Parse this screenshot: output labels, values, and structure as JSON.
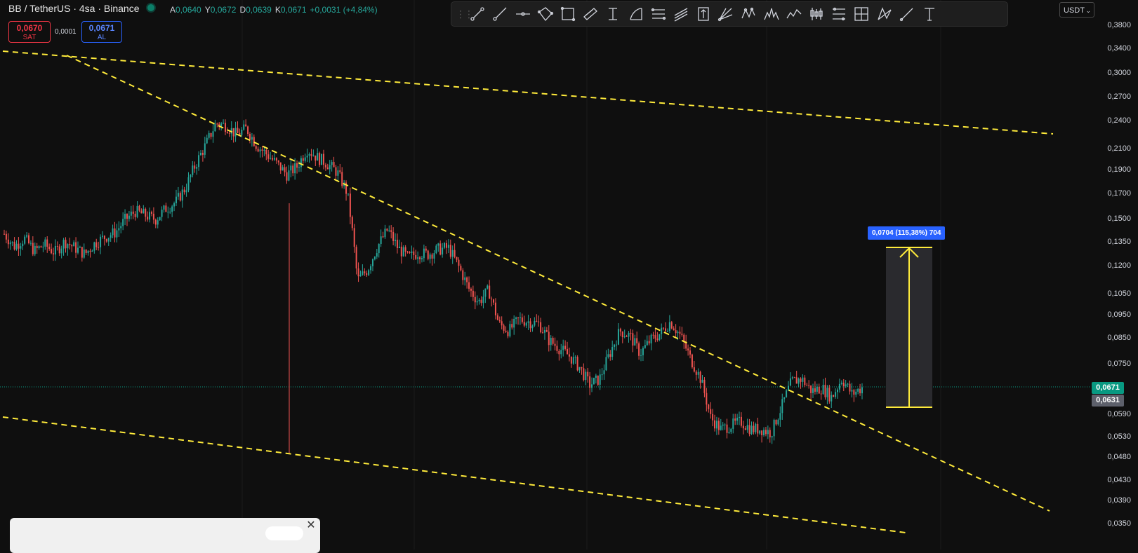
{
  "legend": {
    "symbol": "BB / TetherUS · 4sa · Binance",
    "ohlc": [
      {
        "k": "A",
        "v": "0,0640"
      },
      {
        "k": "Y",
        "v": "0,0672"
      },
      {
        "k": "D",
        "v": "0,0639"
      },
      {
        "k": "K",
        "v": "0,0671"
      },
      {
        "k": "",
        "v": "+0,0031 (+4,84%)"
      }
    ]
  },
  "trade": {
    "sell_price": "0,0670",
    "sell_label": "SAT",
    "spread": "0,0001",
    "buy_price": "0,0671",
    "buy_label": "AL"
  },
  "currency": "USDT",
  "toolbar": {
    "tools": [
      "trend-line",
      "ray",
      "horizontal-line",
      "parallel-channel",
      "rectangle",
      "rotated-rectangle",
      "cross-line",
      "arc",
      "fib-retracement",
      "regression-trend",
      "long-position",
      "pitchfork",
      "xabcd-pattern",
      "head-and-shoulders",
      "elliott-wave",
      "candle-pattern",
      "price-range",
      "date-price-range",
      "triangle-pattern",
      "brush",
      "text"
    ]
  },
  "price_scale": {
    "ticks": [
      "0,3800",
      "0,3400",
      "0,3000",
      "0,2700",
      "0,2400",
      "0,2100",
      "0,1900",
      "0,1700",
      "0,1500",
      "0,1350",
      "0,1200",
      "0,1050",
      "0,0950",
      "0,0850",
      "0,0750",
      "0,0671",
      "0,0631",
      "0,0590",
      "0,0530",
      "0,0480",
      "0,0430",
      "0,0390",
      "0,0350"
    ],
    "current_price": "0,0671",
    "current_color": "#089981",
    "secondary_price": "0,0631",
    "secondary_color": "#5d606b"
  },
  "measure": {
    "label": "0,0704 (115,38%) 704",
    "color": "#2962ff"
  },
  "chart_data": {
    "type": "candlestick",
    "scale": "log",
    "ylim": [
      0.034,
      0.39
    ],
    "close_series": [
      0.14,
      0.132,
      0.137,
      0.129,
      0.133,
      0.128,
      0.135,
      0.131,
      0.127,
      0.134,
      0.138,
      0.141,
      0.15,
      0.156,
      0.153,
      0.15,
      0.158,
      0.163,
      0.175,
      0.196,
      0.215,
      0.238,
      0.235,
      0.225,
      0.232,
      0.214,
      0.205,
      0.196,
      0.186,
      0.193,
      0.21,
      0.202,
      0.196,
      0.188,
      0.17,
      0.112,
      0.118,
      0.132,
      0.143,
      0.131,
      0.125,
      0.128,
      0.127,
      0.13,
      0.131,
      0.12,
      0.108,
      0.101,
      0.107,
      0.091,
      0.088,
      0.093,
      0.092,
      0.091,
      0.084,
      0.081,
      0.078,
      0.074,
      0.068,
      0.07,
      0.079,
      0.088,
      0.086,
      0.079,
      0.084,
      0.087,
      0.092,
      0.086,
      0.077,
      0.07,
      0.058,
      0.055,
      0.056,
      0.057,
      0.055,
      0.055,
      0.054,
      0.061,
      0.069,
      0.07,
      0.066,
      0.067,
      0.064,
      0.07,
      0.065,
      0.0671
    ],
    "trend_lines": [
      "upper-outer",
      "upper-inner",
      "lower-channel"
    ],
    "colors": {
      "up": "#26a69a",
      "down": "#ef5350",
      "trend": "#ffeb3b"
    }
  }
}
